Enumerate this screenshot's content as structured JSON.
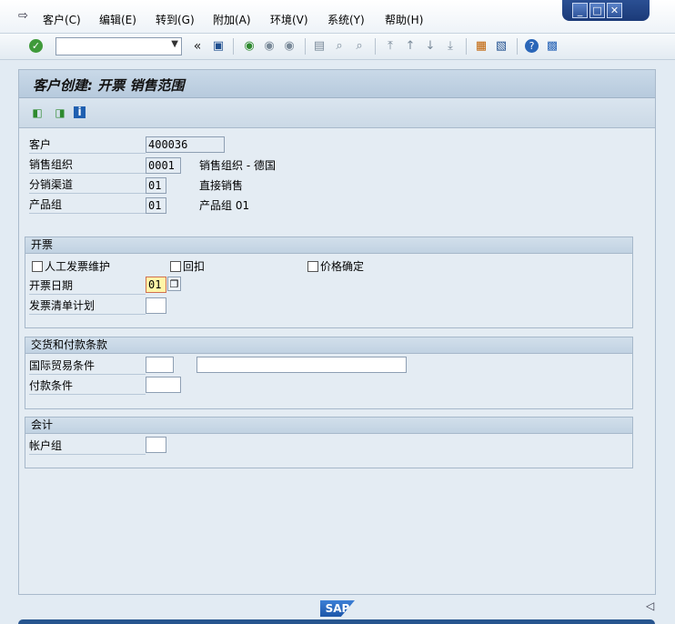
{
  "menu": {
    "items": [
      "客户(C)",
      "编辑(E)",
      "转到(G)",
      "附加(A)",
      "环境(V)",
      "系统(Y)",
      "帮助(H)"
    ]
  },
  "toolbar": {
    "command_value": "",
    "back_double_arrow": "«"
  },
  "page": {
    "title": "客户创建: 开票 销售范围"
  },
  "header_fields": [
    {
      "label": "客户",
      "value": "400036",
      "desc": ""
    },
    {
      "label": "销售组织",
      "value": "0001",
      "desc": "销售组织 - 德国"
    },
    {
      "label": "分销渠道",
      "value": "01",
      "desc": "直接销售"
    },
    {
      "label": "产品组",
      "value": "01",
      "desc": "产品组 01"
    }
  ],
  "groups": {
    "billing": {
      "title": "开票",
      "manual_invoice_label": "人工发票维护",
      "rebate_label": "回扣",
      "pricing_label": "价格确定",
      "billing_date_label": "开票日期",
      "billing_date_value": "01",
      "invoice_list_label": "发票清单计划",
      "invoice_list_value": ""
    },
    "delivery": {
      "title": "交货和付款条款",
      "incoterms_label": "国际贸易条件",
      "incoterms_value": "",
      "incoterms_text": "",
      "payment_terms_label": "付款条件",
      "payment_terms_value": ""
    },
    "accounting": {
      "title": "会计",
      "account_group_label": "帐户组",
      "account_group_value": ""
    }
  },
  "footer": {
    "logo_text": "SAP",
    "scroll_arrow": "◁"
  }
}
